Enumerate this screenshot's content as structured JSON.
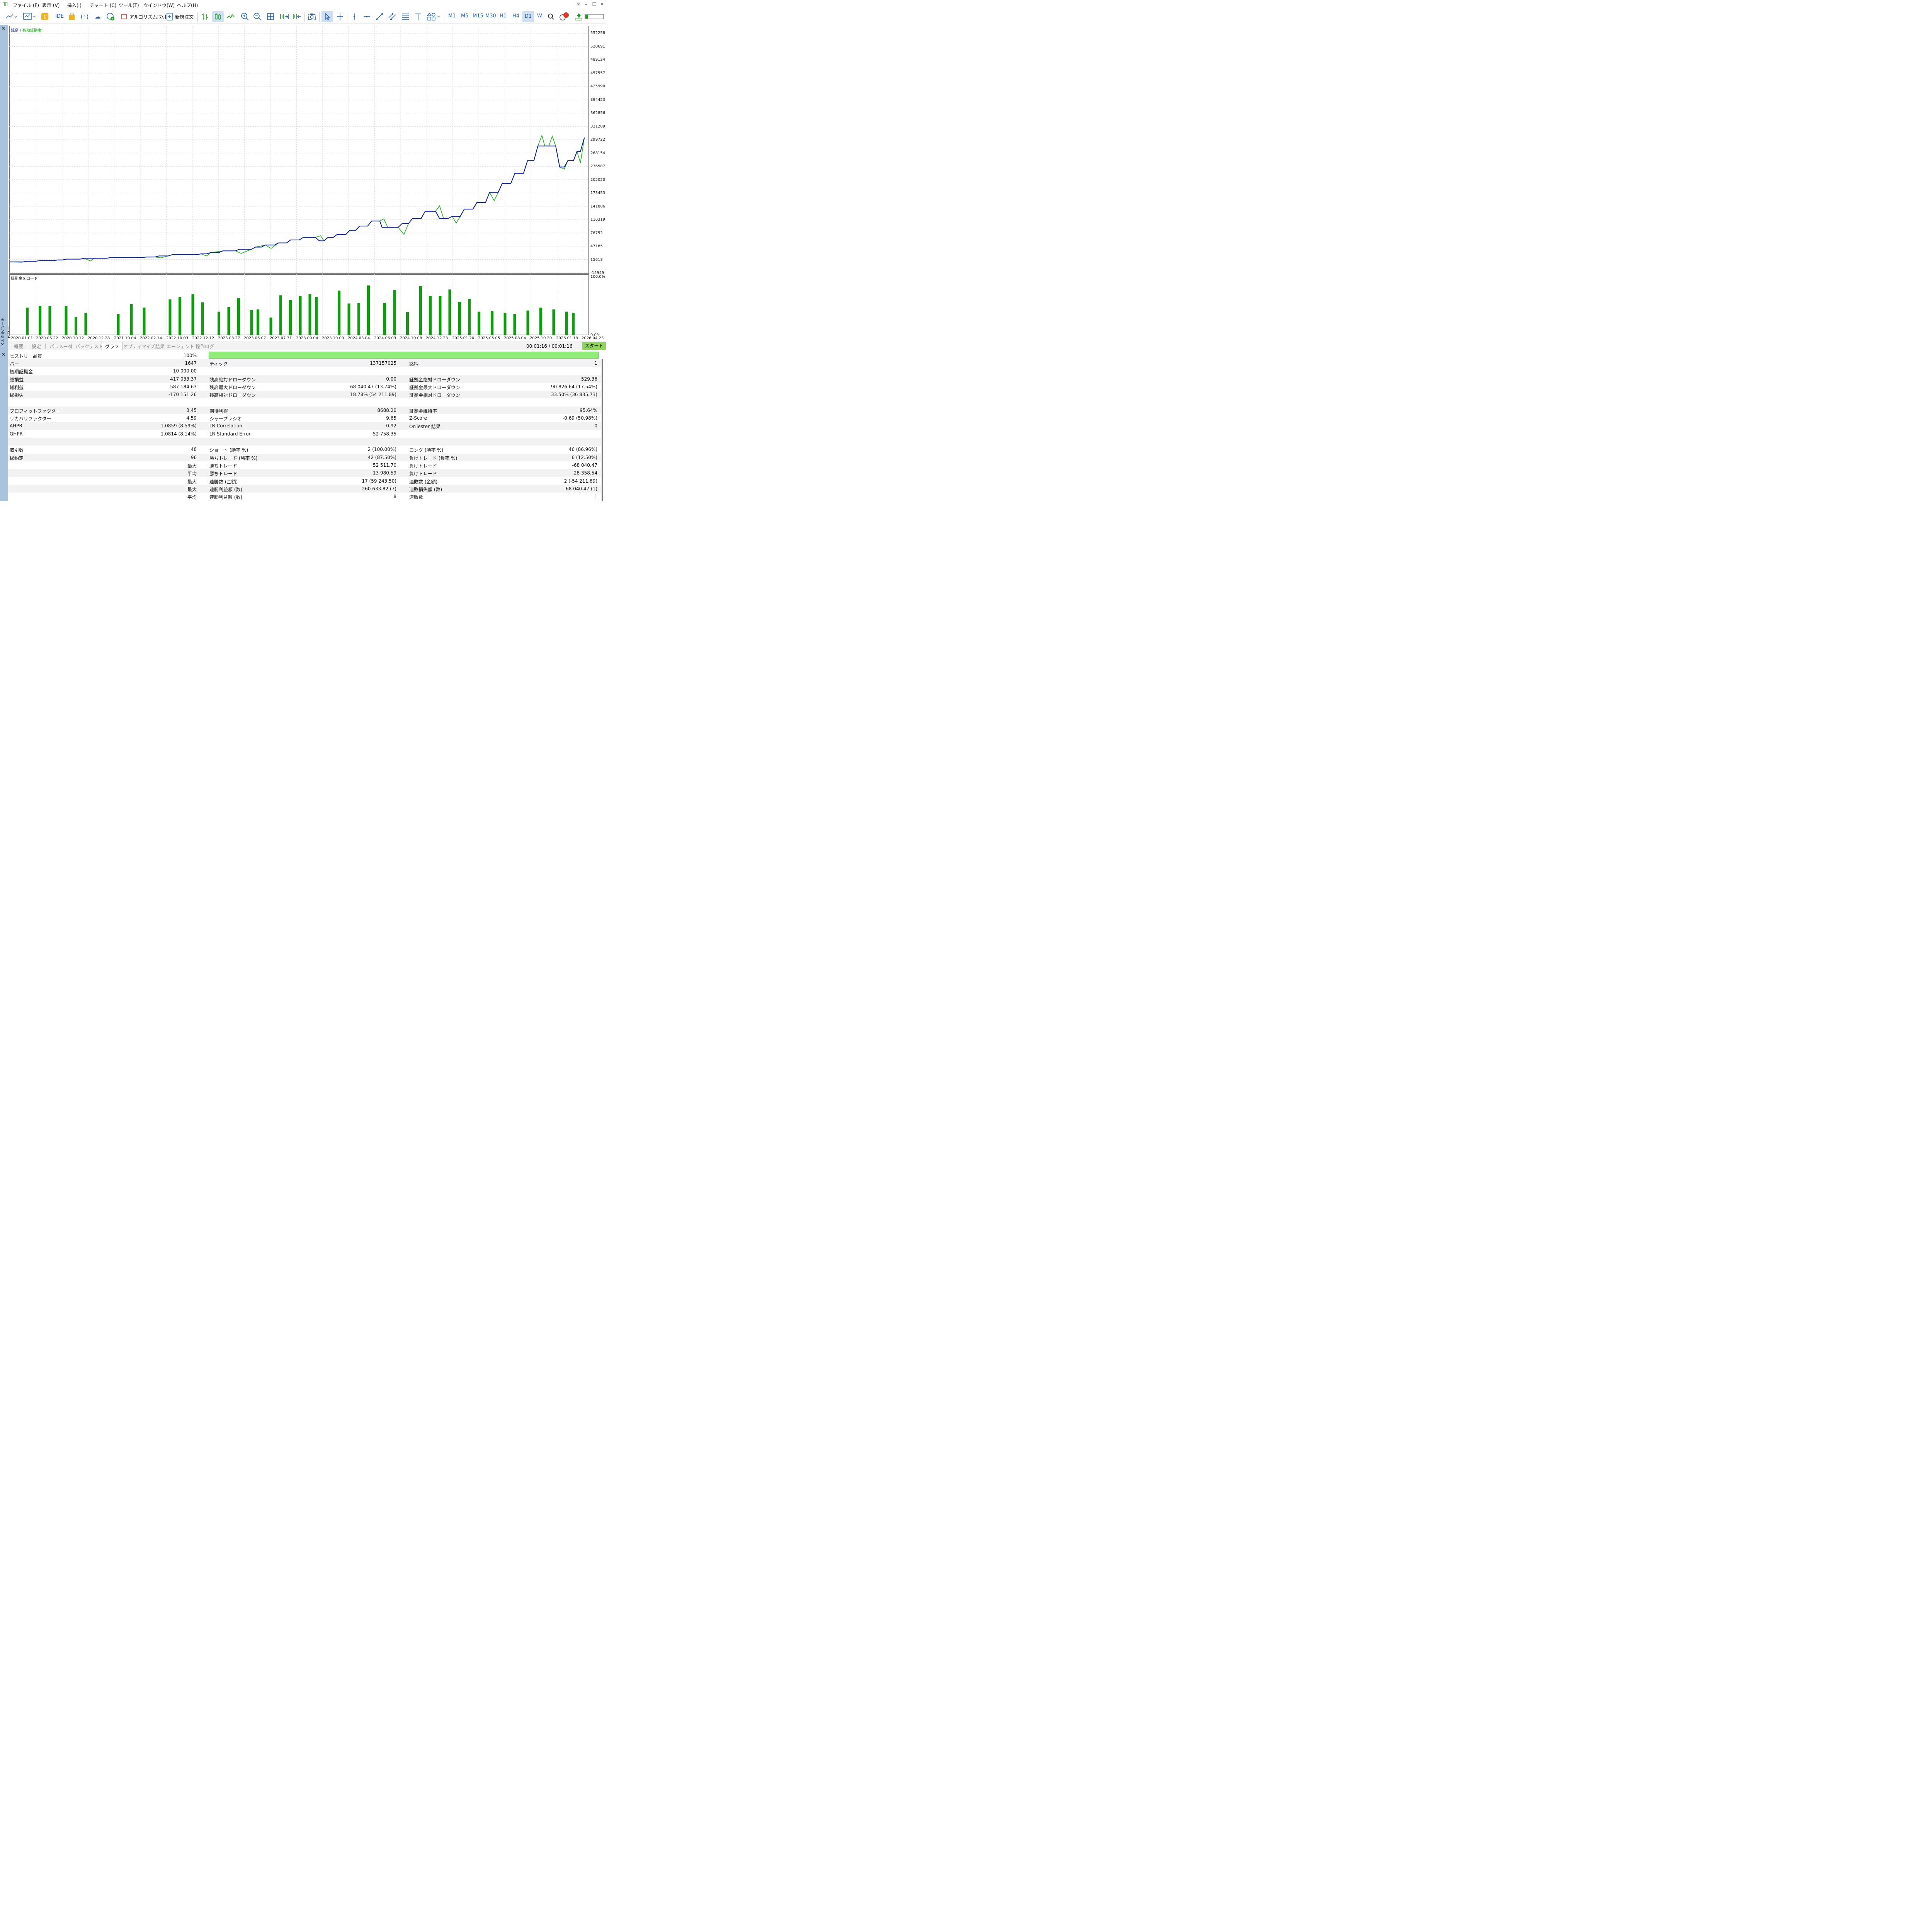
{
  "menu": {
    "items": [
      "ファイル (F)",
      "表示 (V)",
      "挿入(I)",
      "チャート (C)",
      "ツール(T)",
      "ウインドウ(W)",
      "ヘルプ(H)"
    ]
  },
  "toolbar": {
    "ide": "IDE",
    "algo": "アルゴリズム取引",
    "new_order": "新規注文",
    "timeframes": [
      "M1",
      "M5",
      "M15",
      "M30",
      "H1",
      "H4",
      "D1",
      "W"
    ],
    "active_timeframe": "D1",
    "notifications": "1"
  },
  "colors": {
    "balance": "#0a1aa8",
    "equity": "#19b219",
    "load_bar": "#0a9e0a",
    "start": "#8fd45c",
    "quality": "#90ee78"
  },
  "side_label": "ストラテジーテスター",
  "chart": {
    "legend_balance": "残高",
    "legend_sep": "/",
    "legend_equity": "有効証拠金",
    "y_labels": [
      "552258",
      "520691",
      "489124",
      "457557",
      "425990",
      "394423",
      "362856",
      "331289",
      "299722",
      "268154",
      "236587",
      "205020",
      "173453",
      "141886",
      "110319",
      "78752",
      "47185",
      "15618",
      "-15949"
    ],
    "x_labels": [
      "2020.01.01",
      "2020.06.22",
      "2020.10.12",
      "2020.12.28",
      "2021.10.04",
      "2022.02.14",
      "2022.10.03",
      "2022.12.12",
      "2023.03.27",
      "2023.06.07",
      "2023.07.31",
      "2023.09.04",
      "2023.10.09",
      "2024.03.04",
      "2024.06.03",
      "2024.10.08",
      "2024.12.23",
      "2025.01.20",
      "2025.05.05",
      "2025.08.04",
      "2025.10.20",
      "2026.01.19",
      "2026.04.23"
    ]
  },
  "chart_data": {
    "type": "line",
    "y_range": [
      -15949,
      568000
    ],
    "x_range": [
      0,
      100
    ],
    "series": [
      {
        "name": "残高",
        "points": [
          [
            0,
            10000
          ],
          [
            2.3,
            10000
          ],
          [
            3.0,
            11500
          ],
          [
            4.5,
            11500
          ],
          [
            5.2,
            13000
          ],
          [
            7.6,
            13000
          ],
          [
            8.3,
            14500
          ],
          [
            9.1,
            14500
          ],
          [
            9.8,
            16500
          ],
          [
            12.2,
            16500
          ],
          [
            12.9,
            18500
          ],
          [
            16.8,
            18500
          ],
          [
            17.4,
            20000
          ],
          [
            18.7,
            20000
          ],
          [
            19.6,
            20000
          ],
          [
            23.0,
            20000
          ],
          [
            23.7,
            21500
          ],
          [
            25.2,
            21500
          ],
          [
            25.9,
            24000
          ],
          [
            27.5,
            24000
          ],
          [
            28.2,
            27000
          ],
          [
            32.5,
            27000
          ],
          [
            33.2,
            29000
          ],
          [
            34.2,
            29000
          ],
          [
            34.9,
            32000
          ],
          [
            36.3,
            32000
          ],
          [
            37.0,
            36000
          ],
          [
            39.2,
            36000
          ],
          [
            39.9,
            40000
          ],
          [
            42.0,
            40000
          ],
          [
            42.7,
            45000
          ],
          [
            43.7,
            45000
          ],
          [
            44.4,
            50000
          ],
          [
            46.0,
            50000
          ],
          [
            46.7,
            55000
          ],
          [
            48.1,
            55000
          ],
          [
            48.8,
            62000
          ],
          [
            50.3,
            62000
          ],
          [
            51.0,
            68000
          ],
          [
            53.1,
            68000
          ],
          [
            53.8,
            60000
          ],
          [
            54.6,
            60000
          ],
          [
            55.3,
            68000
          ],
          [
            56.2,
            68000
          ],
          [
            56.9,
            75000
          ],
          [
            58.4,
            75000
          ],
          [
            59.1,
            85000
          ],
          [
            60.1,
            85000
          ],
          [
            60.8,
            95000
          ],
          [
            62.2,
            95000
          ],
          [
            62.9,
            107000
          ],
          [
            64.3,
            107000
          ],
          [
            64.7,
            92000
          ],
          [
            67.5,
            92000
          ],
          [
            68.2,
            101000
          ],
          [
            69.3,
            101000
          ],
          [
            70.0,
            113000
          ],
          [
            71.5,
            113000
          ],
          [
            72.2,
            130000
          ],
          [
            74.0,
            130000
          ],
          [
            74.7,
            113000
          ],
          [
            76.2,
            113000
          ],
          [
            76.9,
            118000
          ],
          [
            78.3,
            118000
          ],
          [
            79.0,
            135000
          ],
          [
            80.5,
            135000
          ],
          [
            81.2,
            151000
          ],
          [
            82.7,
            151000
          ],
          [
            83.4,
            175000
          ],
          [
            84.9,
            175000
          ],
          [
            85.6,
            196000
          ],
          [
            87.1,
            196000
          ],
          [
            87.8,
            220000
          ],
          [
            89.3,
            220000
          ],
          [
            90.0,
            250000
          ],
          [
            91.1,
            250000
          ],
          [
            91.8,
            285000
          ],
          [
            93.0,
            285000
          ],
          [
            93.7,
            285000
          ],
          [
            94.9,
            285000
          ],
          [
            95.6,
            235000
          ],
          [
            96.4,
            235000
          ],
          [
            97.0,
            250000
          ],
          [
            98.0,
            250000
          ],
          [
            98.6,
            272000
          ],
          [
            99.2,
            272000
          ],
          [
            99.9,
            305000
          ]
        ]
      },
      {
        "name": "有効証拠金",
        "points": [
          [
            0,
            10000
          ],
          [
            2.0,
            9000
          ],
          [
            3.0,
            11500
          ],
          [
            4.5,
            11500
          ],
          [
            5.2,
            13000
          ],
          [
            7.6,
            13000
          ],
          [
            8.3,
            14500
          ],
          [
            9.1,
            14500
          ],
          [
            9.8,
            16500
          ],
          [
            12.2,
            16500
          ],
          [
            12.9,
            18500
          ],
          [
            14.0,
            12000
          ],
          [
            14.6,
            18500
          ],
          [
            16.8,
            18500
          ],
          [
            17.4,
            20000
          ],
          [
            25.2,
            21500
          ],
          [
            26.2,
            19500
          ],
          [
            27.5,
            24000
          ],
          [
            28.2,
            27000
          ],
          [
            32.5,
            27000
          ],
          [
            33.2,
            29000
          ],
          [
            34.2,
            24000
          ],
          [
            34.9,
            32000
          ],
          [
            37.0,
            36000
          ],
          [
            39.2,
            36000
          ],
          [
            40.2,
            30000
          ],
          [
            42.0,
            40000
          ],
          [
            42.7,
            45000
          ],
          [
            44.4,
            50000
          ],
          [
            45.4,
            42000
          ],
          [
            46.7,
            55000
          ],
          [
            48.1,
            55000
          ],
          [
            48.8,
            62000
          ],
          [
            50.3,
            62000
          ],
          [
            51.0,
            68000
          ],
          [
            53.1,
            68000
          ],
          [
            54.0,
            72000
          ],
          [
            54.6,
            60000
          ],
          [
            55.3,
            68000
          ],
          [
            56.2,
            68000
          ],
          [
            56.9,
            75000
          ],
          [
            58.4,
            75000
          ],
          [
            59.1,
            85000
          ],
          [
            60.1,
            85000
          ],
          [
            60.8,
            95000
          ],
          [
            62.2,
            95000
          ],
          [
            62.9,
            107000
          ],
          [
            64.3,
            107000
          ],
          [
            65.0,
            112000
          ],
          [
            65.7,
            92000
          ],
          [
            67.5,
            92000
          ],
          [
            68.5,
            75000
          ],
          [
            69.3,
            101000
          ],
          [
            70.0,
            113000
          ],
          [
            71.5,
            113000
          ],
          [
            72.2,
            130000
          ],
          [
            74.0,
            130000
          ],
          [
            74.7,
            143000
          ],
          [
            75.4,
            113000
          ],
          [
            76.2,
            113000
          ],
          [
            76.9,
            118000
          ],
          [
            77.6,
            102000
          ],
          [
            78.3,
            118000
          ],
          [
            79.0,
            135000
          ],
          [
            80.5,
            135000
          ],
          [
            81.2,
            151000
          ],
          [
            82.7,
            151000
          ],
          [
            83.4,
            175000
          ],
          [
            84.2,
            155000
          ],
          [
            84.9,
            175000
          ],
          [
            85.6,
            196000
          ],
          [
            87.1,
            196000
          ],
          [
            87.8,
            220000
          ],
          [
            89.3,
            220000
          ],
          [
            90.0,
            250000
          ],
          [
            91.1,
            250000
          ],
          [
            91.8,
            285000
          ],
          [
            92.5,
            310000
          ],
          [
            93.0,
            285000
          ],
          [
            93.7,
            285000
          ],
          [
            94.3,
            308000
          ],
          [
            94.9,
            285000
          ],
          [
            95.6,
            235000
          ],
          [
            96.4,
            230000
          ],
          [
            97.0,
            250000
          ],
          [
            98.0,
            250000
          ],
          [
            98.6,
            272000
          ],
          [
            99.2,
            245000
          ],
          [
            99.9,
            305000
          ]
        ]
      }
    ]
  },
  "load_chart": {
    "label": "証拠金をロード",
    "y_max_label": "100.0%",
    "y_min_label": "0.0%"
  },
  "load_data": {
    "type": "bar",
    "y_range": [
      0,
      100
    ],
    "bars": [
      [
        70.5,
        47
      ],
      [
        103.5,
        50
      ],
      [
        129.0,
        50
      ],
      [
        171.0,
        50
      ],
      [
        196.5,
        31
      ],
      [
        222.0,
        38
      ],
      [
        306.0,
        36
      ],
      [
        340.0,
        53
      ],
      [
        373.0,
        47
      ],
      [
        440.0,
        61
      ],
      [
        465.5,
        65
      ],
      [
        499.0,
        70
      ],
      [
        524.5,
        56
      ],
      [
        566.5,
        40
      ],
      [
        592.0,
        48
      ],
      [
        617.5,
        63
      ],
      [
        651.0,
        43
      ],
      [
        667.5,
        44
      ],
      [
        701.0,
        30
      ],
      [
        726.5,
        68
      ],
      [
        751.5,
        60
      ],
      [
        777.0,
        67
      ],
      [
        802.0,
        70
      ],
      [
        819.0,
        65
      ],
      [
        877.5,
        76
      ],
      [
        903.0,
        54
      ],
      [
        928.5,
        55
      ],
      [
        953.5,
        85
      ],
      [
        995.5,
        55
      ],
      [
        1021.0,
        77
      ],
      [
        1054.5,
        39
      ],
      [
        1088.5,
        84
      ],
      [
        1113.5,
        67
      ],
      [
        1139.0,
        67
      ],
      [
        1164.0,
        78
      ],
      [
        1189.5,
        57
      ],
      [
        1214.5,
        62
      ],
      [
        1239.5,
        40
      ],
      [
        1273.5,
        41
      ],
      [
        1307.0,
        38
      ],
      [
        1332.0,
        36
      ],
      [
        1366.0,
        42
      ],
      [
        1399.5,
        47
      ],
      [
        1433.0,
        44
      ],
      [
        1466.5,
        40
      ],
      [
        1483.5,
        38
      ]
    ]
  },
  "tabs": [
    "概要",
    "設定",
    "パラメータ",
    "バックテスト",
    "グラフ",
    "オプティマイズ結果",
    "エージェント",
    "操作ログ"
  ],
  "active_tab": "グラフ",
  "timer": "00:01:16 / 00:01:16",
  "start": "スタート",
  "report": {
    "history_quality_label": "ヒストリー品質",
    "history_quality_value": "100%",
    "history_quality_fraction": 1.0,
    "rows": [
      [
        "バー",
        "1647",
        "ティック",
        "137157025",
        "銘柄",
        "1"
      ],
      [
        "初期証拠金",
        "10 000.00",
        "",
        "",
        "",
        ""
      ],
      [
        "総損益",
        "417 033.37",
        "残高絶対ドローダウン",
        "0.00",
        "証拠金絶対ドローダウン",
        "529.36"
      ],
      [
        "総利益",
        "587 184.63",
        "残高最大ドローダウン",
        "68 040.47 (13.74%)",
        "証拠金最大ドローダウン",
        "90 826.64 (17.54%)"
      ],
      [
        "総損失",
        "-170 151.26",
        "残高相対ドローダウン",
        "18.78% (54 211.89)",
        "証拠金相対ドローダウン",
        "33.50% (36 835.73)"
      ],
      [
        "",
        "",
        "",
        "",
        "",
        ""
      ],
      [
        "プロフィットファクター",
        "3.45",
        "期待利得",
        "8688.20",
        "証拠金維持率",
        "95.64%"
      ],
      [
        "リカバリファクター",
        "4.59",
        "シャープレシオ",
        "9.65",
        "Z-Score",
        "-0.69 (50.98%)"
      ],
      [
        "AHPR",
        "1.0859 (8.59%)",
        "LR Correlation",
        "0.92",
        "OnTester 結果",
        "0"
      ],
      [
        "GHPR",
        "1.0814 (8.14%)",
        "LR Standard Error",
        "52 758.35",
        "",
        ""
      ],
      [
        "",
        "",
        "",
        "",
        "",
        ""
      ],
      [
        "取引数",
        "48",
        "ショート (勝率 %)",
        "2 (100.00%)",
        "ロング (勝率 %)",
        "46 (86.96%)"
      ],
      [
        "総約定",
        "96",
        "勝ちトレード (勝率 %)",
        "42 (87.50%)",
        "負けトレード (負率 %)",
        "6 (12.50%)"
      ],
      [
        "",
        "最大",
        "勝ちトレード",
        "52 511.70",
        "負けトレード",
        "-68 040.47"
      ],
      [
        "",
        "平均",
        "勝ちトレード",
        "13 980.59",
        "負けトレード",
        "-28 358.54"
      ],
      [
        "",
        "最大",
        "連勝数 (金額)",
        "17 (59 243.50)",
        "連敗数 (金額)",
        "2 (-54 211.89)"
      ],
      [
        "",
        "最大",
        "連勝利益額 (数)",
        "260 633.82 (7)",
        "連敗損失額 (数)",
        "-68 040.47 (1)"
      ],
      [
        "",
        "平均",
        "連勝利益額 (数)",
        "8",
        "連敗数",
        "1"
      ]
    ]
  }
}
